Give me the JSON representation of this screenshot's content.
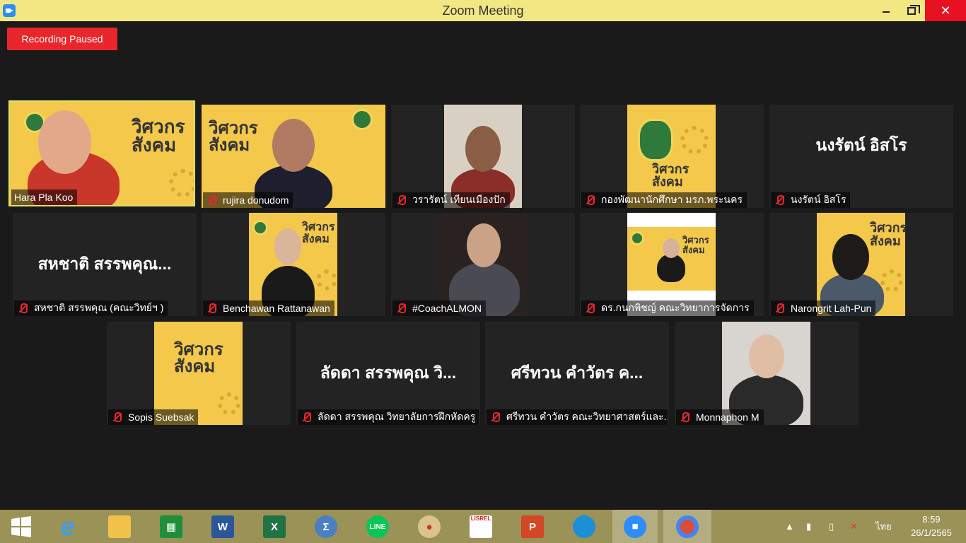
{
  "window": {
    "title": "Zoom Meeting",
    "minimize_icon": "minimize-icon",
    "maximize_icon": "restore-icon",
    "close_icon": "close-icon"
  },
  "recording": {
    "label": "Recording Paused",
    "color": "#e8262b"
  },
  "participants": [
    {
      "name": "Hara Pla Koo",
      "muted": false,
      "active": true
    },
    {
      "name": "rujira donudom",
      "muted": true
    },
    {
      "name": "วรารัตน์ เทียนเมืองปัก",
      "muted": true
    },
    {
      "name": "กองพัฒนานักศึกษา มรภ.พระนคร",
      "muted": true
    },
    {
      "name": "นงรัตน์ อิสโร",
      "muted": true,
      "display_text": "นงรัตน์ อิสโร"
    },
    {
      "name": "สหชาติ สรรพคุณ (คณะวิทย์ฯ )",
      "muted": true,
      "display_text": "สหชาติ สรรพคุณ..."
    },
    {
      "name": "Benchawan Rattanawan",
      "muted": true
    },
    {
      "name": "#CoachALMON",
      "muted": true
    },
    {
      "name": "ดร.กนกพิชญ์ คณะวิทยาการจัดการ",
      "muted": true
    },
    {
      "name": "Narongrit Lah-Pun",
      "muted": true
    },
    {
      "name": "Sopis Suebsak",
      "muted": true
    },
    {
      "name": "ลัดดา สรรพคุณ วิทยาลัยการฝึกหัดครู",
      "muted": true,
      "display_text": "ลัดดา สรรพคุณ วิ..."
    },
    {
      "name": "ศรีทวน  คำวัตร คณะวิทยาศาสตร์และ...",
      "muted": true,
      "display_text": "ศรีทวน  คำวัตร ค..."
    },
    {
      "name": "Monnaphon M",
      "muted": true
    }
  ],
  "poster": {
    "title_line1": "วิศวกร",
    "title_line2": "สังคม",
    "accent": "#f3c84b"
  },
  "taskbar": {
    "icons": [
      "windows-start-icon",
      "internet-explorer-icon",
      "file-explorer-icon",
      "store-icon",
      "word-icon",
      "excel-icon",
      "math-icon",
      "line-icon",
      "paint-icon",
      "lisrel-icon",
      "powerpoint-icon",
      "edge-icon",
      "zoom-icon",
      "chrome-icon"
    ],
    "word_letter": "W",
    "excel_letter": "X",
    "ppt_letter": "P",
    "line_label": "LINE",
    "lisrel_label": "LISREL",
    "language": "ไทย",
    "time": "8:59",
    "date": "26/1/2565"
  }
}
